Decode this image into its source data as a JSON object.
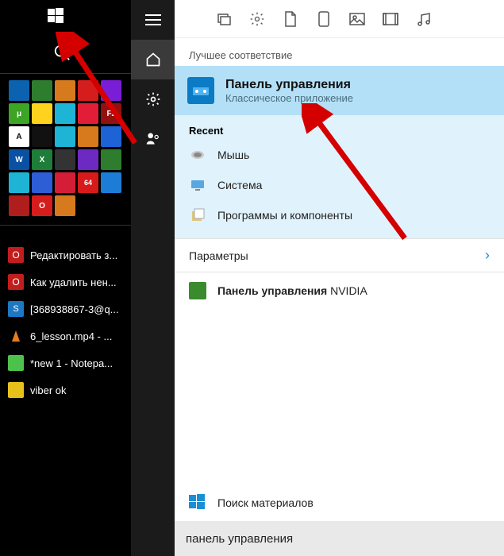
{
  "taskbar": {
    "task_items": [
      {
        "label": "Редактировать з...",
        "bg": "#c21d1d"
      },
      {
        "label": "Как удалить нен...",
        "bg": "#c21d1d"
      },
      {
        "label": "[368938867-3@q...",
        "bg": "#1d77c2"
      },
      {
        "label": "6_lesson.mp4 - ...",
        "bg": "#e87b1a"
      },
      {
        "label": "*new 1 - Notepa...",
        "bg": "#4cc24c"
      },
      {
        "label": "viber ok",
        "bg": "#e8c21a"
      }
    ]
  },
  "search": {
    "best_match_header": "Лучшее соответствие",
    "best": {
      "title": "Панель управления",
      "subtitle": "Классическое приложение"
    },
    "recent_header": "Recent",
    "recent": [
      {
        "label": "Мышь"
      },
      {
        "label": "Система"
      },
      {
        "label": "Программы и компоненты"
      }
    ],
    "settings_header": "Параметры",
    "nvidia": {
      "bold": "Панель управления",
      "tail": " NVIDIA"
    },
    "store": "Поиск материалов",
    "query": "панель управления"
  }
}
